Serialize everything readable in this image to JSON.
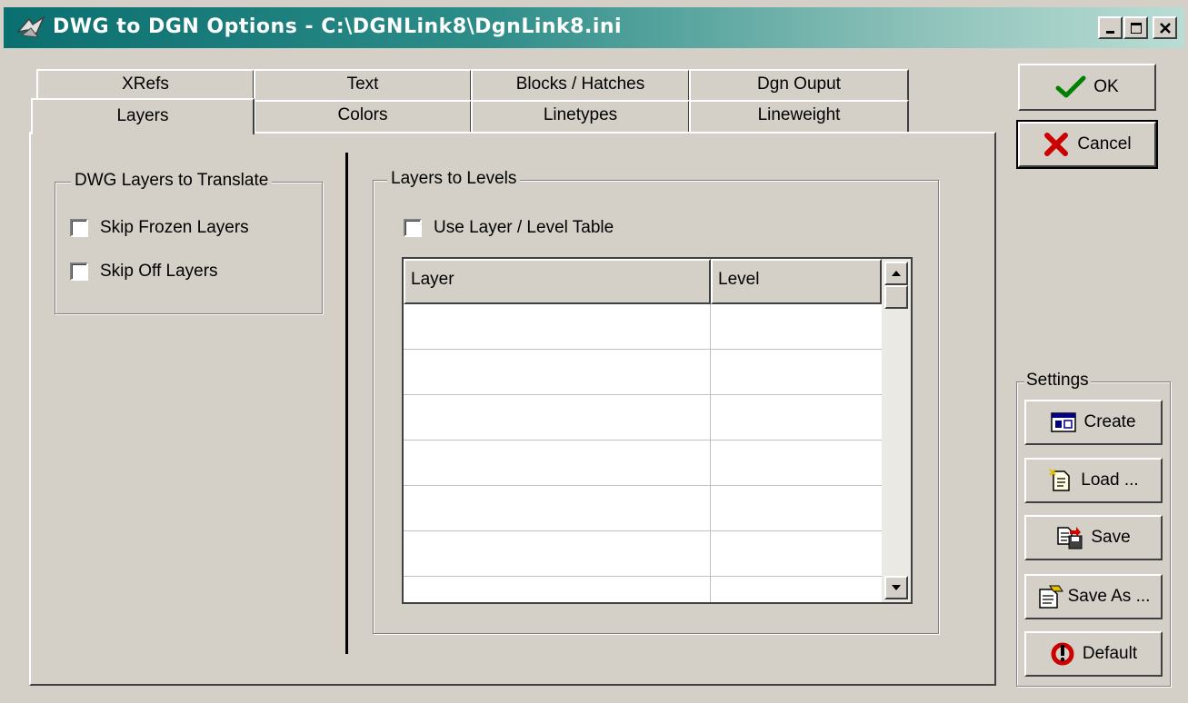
{
  "window": {
    "title": "DWG to DGN Options - C:\\DGNLink8\\DgnLink8.ini",
    "minimize_icon": "minimize-icon",
    "maximize_icon": "maximize-icon",
    "close_icon": "close-icon"
  },
  "tabs": {
    "back_row": [
      "XRefs",
      "Text",
      "Blocks / Hatches",
      "Dgn Ouput"
    ],
    "front_row": [
      "Layers",
      "Colors",
      "Linetypes",
      "Lineweight"
    ],
    "active": "Layers"
  },
  "dwg_layers": {
    "title": "DWG Layers to Translate",
    "skip_frozen": {
      "label": "Skip Frozen Layers",
      "checked": false
    },
    "skip_off": {
      "label": "Skip Off Layers",
      "checked": false
    }
  },
  "layers_to_levels": {
    "title": "Layers to Levels",
    "use_table": {
      "label": "Use Layer / Level Table",
      "checked": false
    },
    "table": {
      "columns": [
        "Layer",
        "Level"
      ],
      "rows": [
        [
          "",
          ""
        ],
        [
          "",
          ""
        ],
        [
          "",
          ""
        ],
        [
          "",
          ""
        ],
        [
          "",
          ""
        ],
        [
          "",
          ""
        ],
        [
          "",
          ""
        ]
      ]
    }
  },
  "buttons": {
    "ok": "OK",
    "cancel": "Cancel"
  },
  "settings": {
    "title": "Settings",
    "create": "Create",
    "load": "Load ...",
    "save": "Save",
    "save_as": "Save As ...",
    "default": "Default"
  },
  "colors": {
    "face": "#d4d0c8",
    "title_start": "#0a6f6f",
    "title_end": "#b9ddd4",
    "ok_check": "#008000",
    "cancel_x": "#cc0000"
  }
}
